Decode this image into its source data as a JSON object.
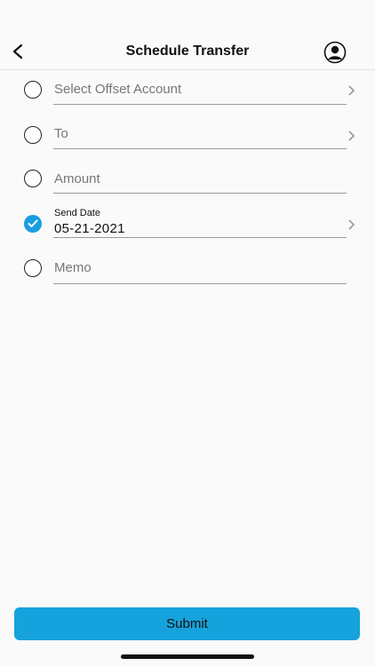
{
  "header": {
    "title": "Schedule Transfer",
    "back_icon": "chevron-left-icon",
    "profile_icon": "user-icon"
  },
  "form": {
    "fields": [
      {
        "label": "Select Offset Account",
        "checked": false,
        "has_chevron": true
      },
      {
        "label": "To",
        "checked": false,
        "has_chevron": true
      },
      {
        "label": "Amount",
        "checked": false,
        "has_chevron": false
      },
      {
        "label": "Send Date",
        "value": "05-21-2021",
        "checked": true,
        "has_chevron": true
      },
      {
        "label": "Memo",
        "checked": false,
        "has_chevron": false
      }
    ]
  },
  "submit": {
    "label": "Submit"
  },
  "colors": {
    "accent": "#16a2dc",
    "check": "#1a9ee0"
  }
}
